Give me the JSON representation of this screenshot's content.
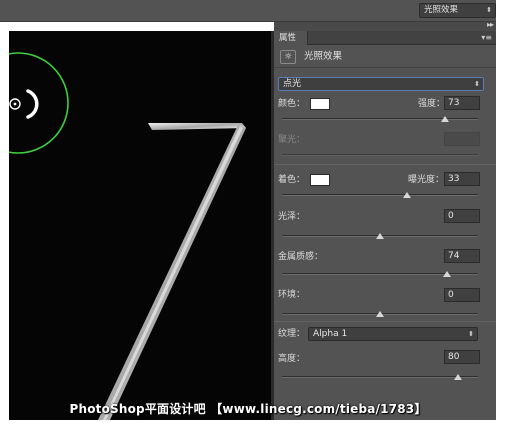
{
  "top_toolbar": {
    "preset_label": "光照效果"
  },
  "panel": {
    "tab_label": "属性",
    "title": "光照效果",
    "light_type": "点光",
    "color_label": "颜色：",
    "intensity_label": "强度：",
    "intensity_value": "73",
    "intensity_pct": 0.83,
    "hotspot_label": "聚光：",
    "colorize_label": "着色：",
    "exposure_label": "曝光度：",
    "exposure_value": "33",
    "exposure_pct": 0.64,
    "gloss_label": "光泽：",
    "gloss_value": "0",
    "gloss_pct": 0.5,
    "metallic_label": "金属质感：",
    "metallic_value": "74",
    "metallic_pct": 0.84,
    "ambience_label": "环境：",
    "ambience_value": "0",
    "ambience_pct": 0.5,
    "texture_label": "纹理：",
    "texture_value": "Alpha 1",
    "height_label": "高度：",
    "height_value": "80",
    "height_pct": 0.9
  },
  "colors": {
    "light_color": "#ffffff",
    "colorize_color": "#ffffff",
    "ring_color": "#3ecf3e",
    "panel_bg": "#535353"
  },
  "icons": {
    "effect_icon": "light-bulb-icon",
    "panel_menu": "panel-menu-icon",
    "collapse": "double-chevron-right-icon"
  },
  "watermark": "PhotoShop平面设计吧 【www.linecg.com/tieba/1783】"
}
